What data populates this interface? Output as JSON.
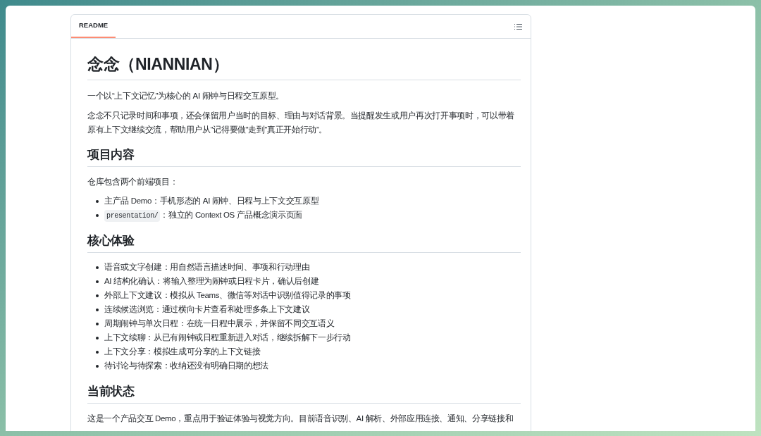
{
  "tab": {
    "label": "README",
    "selected": true
  },
  "blocks": [
    {
      "kind": "h1",
      "text": "念念（NIANNIAN）"
    },
    {
      "kind": "p",
      "text": "一个以“上下文记忆”为核心的 AI 闹钟与日程交互原型。"
    },
    {
      "kind": "p",
      "text": "念念不只记录时间和事项，还会保留用户当时的目标、理由与对话背景。当提醒发生或用户再次打开事项时，可以带着原有上下文继续交流，帮助用户从“记得要做”走到“真正开始行动”。"
    },
    {
      "kind": "h2",
      "text": "项目内容"
    },
    {
      "kind": "p",
      "text": "仓库包含两个前端项目："
    },
    {
      "kind": "ul",
      "items": [
        {
          "text": "主产品 Demo：手机形态的 AI 闹钟、日程与上下文交互原型"
        },
        {
          "code": "presentation/",
          "text": "：独立的 Context OS 产品概念演示页面"
        }
      ]
    },
    {
      "kind": "h2",
      "text": "核心体验"
    },
    {
      "kind": "ul",
      "items": [
        {
          "text": "语音或文字创建：用自然语言描述时间、事项和行动理由"
        },
        {
          "text": "AI 结构化确认：将输入整理为闹钟或日程卡片，确认后创建"
        },
        {
          "text": "外部上下文建议：模拟从 Teams、微信等对话中识别值得记录的事项"
        },
        {
          "text": "连续候选浏览：通过横向卡片查看和处理多条上下文建议"
        },
        {
          "text": "周期闹钟与单次日程：在统一日程中展示，并保留不同交互语义"
        },
        {
          "text": "上下文续聊：从已有闹钟或日程重新进入对话，继续拆解下一步行动"
        },
        {
          "text": "上下文分享：模拟生成可分享的上下文链接"
        },
        {
          "text": "待讨论与待探索：收纳还没有明确日期的想法"
        }
      ]
    },
    {
      "kind": "h2",
      "text": "当前状态"
    },
    {
      "kind": "p",
      "text": "这是一个产品交互 Demo，重点用于验证体验与视觉方向。目前语音识别、AI 解析、外部应用连接、通知、分享链接和"
    }
  ]
}
